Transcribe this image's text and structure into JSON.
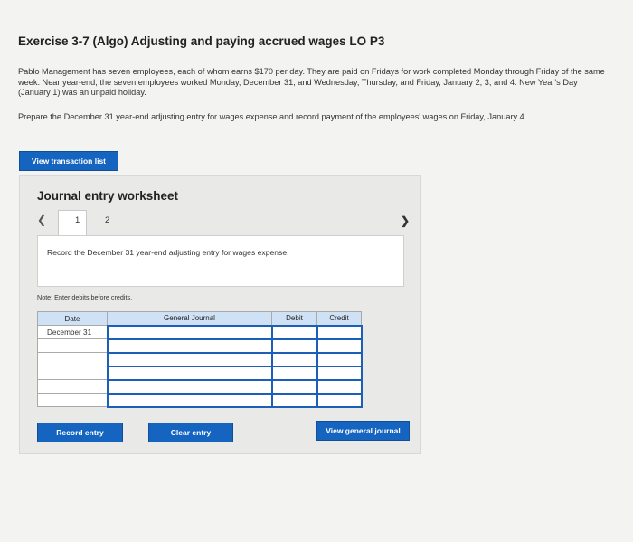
{
  "exercise": {
    "title": "Exercise 3-7 (Algo) Adjusting and paying accrued wages LO P3",
    "paragraph1": "Pablo Management has seven employees, each of whom earns $170 per day. They are paid on Fridays for work completed Monday through Friday of the same week. Near year-end, the seven employees worked Monday, December 31, and Wednesday, Thursday, and Friday, January 2, 3, and 4. New Year's Day (January 1) was an unpaid holiday.",
    "paragraph2": "Prepare the December 31 year-end adjusting entry for wages expense and record payment of the employees' wages on Friday, January 4."
  },
  "buttons": {
    "view_transaction_list": "View transaction list",
    "record_entry": "Record entry",
    "clear_entry": "Clear entry",
    "view_general_journal": "View general journal"
  },
  "worksheet": {
    "title": "Journal entry worksheet",
    "prev_icon": "chevron-left-icon",
    "next_icon": "chevron-right-icon",
    "tabs": [
      "1",
      "2"
    ],
    "active_tab": "1",
    "instruction": "Record the December 31 year-end adjusting entry for wages expense.",
    "note": "Note: Enter debits before credits."
  },
  "journal": {
    "headers": [
      "Date",
      "General Journal",
      "Debit",
      "Credit"
    ],
    "rows": [
      {
        "date": "December 31",
        "account": "",
        "debit": "",
        "credit": ""
      },
      {
        "date": "",
        "account": "",
        "debit": "",
        "credit": ""
      },
      {
        "date": "",
        "account": "",
        "debit": "",
        "credit": ""
      },
      {
        "date": "",
        "account": "",
        "debit": "",
        "credit": ""
      },
      {
        "date": "",
        "account": "",
        "debit": "",
        "credit": ""
      },
      {
        "date": "",
        "account": "",
        "debit": "",
        "credit": ""
      }
    ]
  },
  "colors": {
    "button_blue": "#1565c0",
    "header_blue": "#cfe2f5",
    "input_border": "#1b5fb8"
  }
}
